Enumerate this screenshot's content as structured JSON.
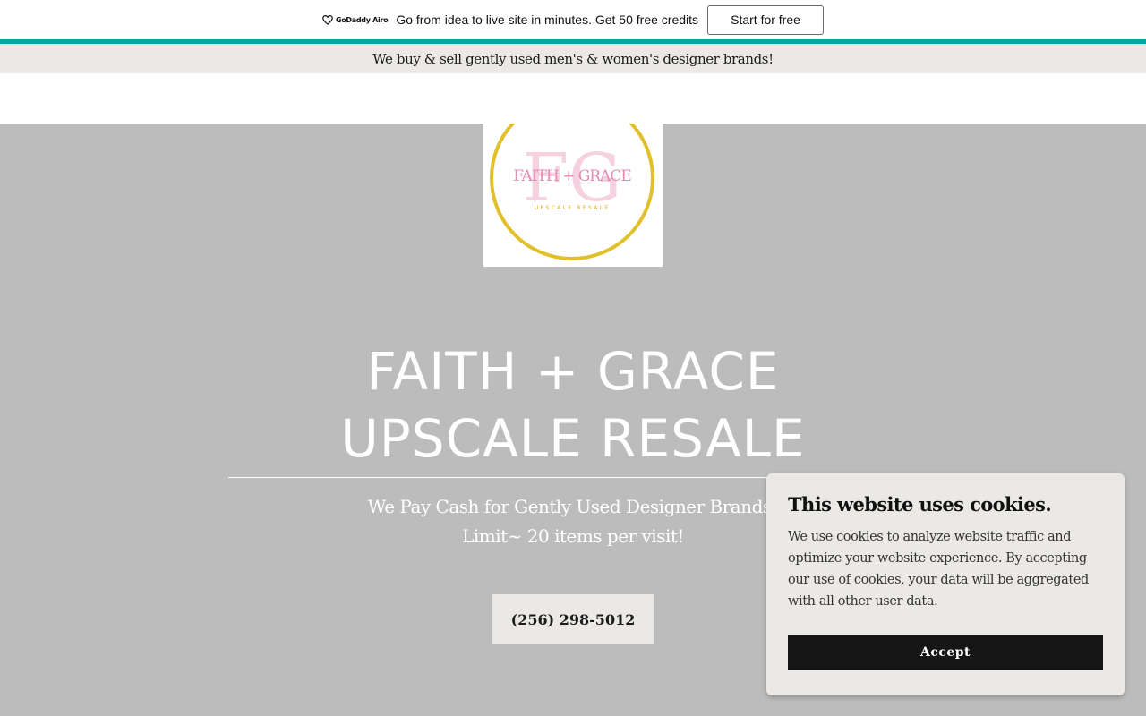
{
  "promo": {
    "brand": "GoDaddy Airo",
    "text": "Go from idea to live site in minutes. Get 50 free credits",
    "button_label": "Start for free",
    "accent_color": "#0aa6a6"
  },
  "announcement": {
    "text": "We buy & sell gently used men's & women's designer brands!"
  },
  "logo": {
    "monogram": "FG",
    "name": "FAITH + GRACE",
    "tagline": "UPSCALE RESALE",
    "ring_color": "#e2c02b",
    "pink_color": "#f4c3d8"
  },
  "hero": {
    "title_line1": "FAITH + GRACE",
    "title_line2": "UPSCALE RESALE",
    "subtitle_line1": "We Pay Cash for Gently Used Designer Brands!",
    "subtitle_line2": "Limit~ 20 items per visit!",
    "phone_label": "(256) 298-5012",
    "background_color": "#bcbcbc"
  },
  "cookie": {
    "title": "This website uses cookies.",
    "body": "We use cookies to analyze website traffic and optimize your website experience. By accepting our use of cookies, your data will be aggregated with all other user data.",
    "accept_label": "Accept"
  }
}
